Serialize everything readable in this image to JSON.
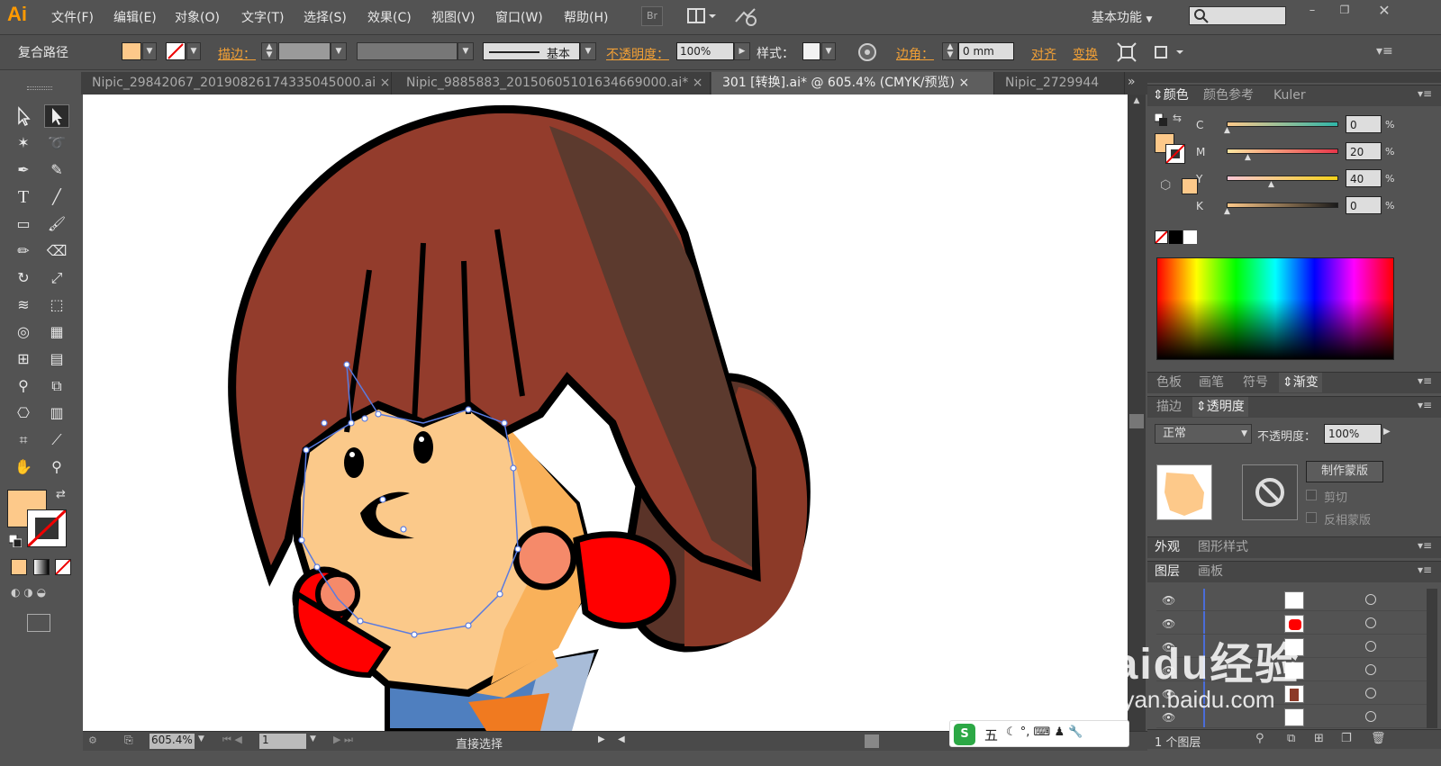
{
  "app": {
    "logo": "Ai",
    "workspace": "基本功能",
    "br_label": "Br"
  },
  "menu": [
    "文件(F)",
    "编辑(E)",
    "对象(O)",
    "文字(T)",
    "选择(S)",
    "效果(C)",
    "视图(V)",
    "窗口(W)",
    "帮助(H)"
  ],
  "control": {
    "object_type": "复合路径",
    "stroke_label": "描边：",
    "stroke_style": "基本",
    "opacity_label": "不透明度：",
    "opacity": "100%",
    "style_label": "样式：",
    "corner_label": "边角：",
    "corner_value": "0 mm",
    "align": "对齐",
    "transform": "变换",
    "fill_color": "#fdc98a"
  },
  "tabs": [
    "Nipic_29842067_20190826174335045000.ai",
    "Nipic_9885883_20150605101634669000.ai*",
    "301 [转换].ai* @ 605.4% (CMYK/预览)",
    "Nipic_2729944"
  ],
  "active_tab": 2,
  "status": {
    "zoom": "605.4%",
    "artboard": "1",
    "tool": "直接选择"
  },
  "color_panel": {
    "tabs": [
      "颜色",
      "颜色参考",
      "Kuler"
    ],
    "c": "0",
    "m": "20",
    "y": "40",
    "k": "0",
    "pct": "%",
    "c_label": "C",
    "m_label": "M",
    "y_label": "Y",
    "k_label": "K"
  },
  "swatch_tabs": [
    "色板",
    "画笔",
    "符号",
    "渐变"
  ],
  "transparency": {
    "tabs": [
      "描边",
      "透明度"
    ],
    "mode": "正常",
    "opacity_label": "不透明度：",
    "opacity": "100%",
    "make_mask": "制作蒙版",
    "clip": "剪切",
    "invert": "反相蒙版"
  },
  "appearance_tabs": [
    "外观",
    "图形样式"
  ],
  "layers": {
    "tabs": [
      "图层",
      "画板"
    ],
    "count": "1 个图层"
  },
  "ime": {
    "text": "五"
  },
  "watermark": {
    "brand": "Baidu经验",
    "url": "jingyan.baidu.com"
  }
}
